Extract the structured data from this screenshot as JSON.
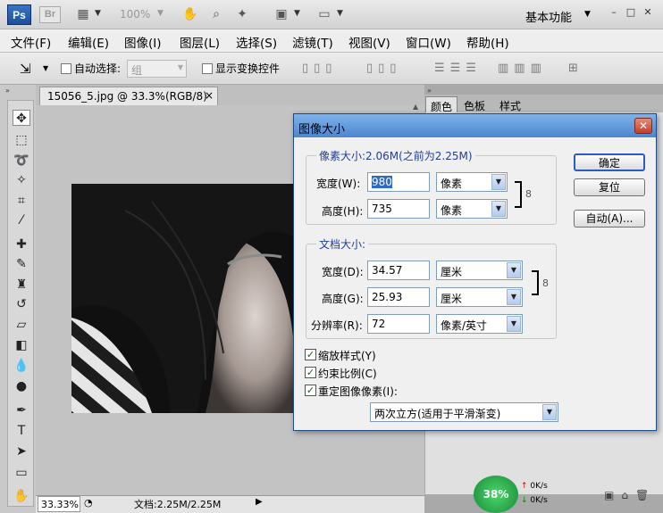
{
  "app": {
    "logo": "Ps",
    "bridge_logo": "Br",
    "zoom_level": "100%",
    "workspace": "基本功能",
    "menus": [
      "文件(F)",
      "编辑(E)",
      "图像(I)",
      "图层(L)",
      "选择(S)",
      "滤镜(T)",
      "视图(V)",
      "窗口(W)",
      "帮助(H)"
    ]
  },
  "options": {
    "auto_select_label": "自动选择:",
    "auto_select_value": "组",
    "show_transform_label": "显示变换控件"
  },
  "document": {
    "tab_title": "15056_5.jpg @ 33.3%(RGB/8)",
    "zoom": "33.33%",
    "doc_size": "文档:2.25M/2.25M"
  },
  "panels": {
    "tabs": [
      "颜色",
      "色板",
      "样式"
    ]
  },
  "dialog": {
    "title": "图像大小",
    "pixel_group_label": "像素大小:2.06M(之前为2.25M)",
    "pixel_width_label": "宽度(W):",
    "pixel_width_value": "980",
    "pixel_width_unit": "像素",
    "pixel_height_label": "高度(H):",
    "pixel_height_value": "735",
    "pixel_height_unit": "像素",
    "doc_group_label": "文档大小:",
    "doc_width_label": "宽度(D):",
    "doc_width_value": "34.57",
    "doc_width_unit": "厘米",
    "doc_height_label": "高度(G):",
    "doc_height_value": "25.93",
    "doc_height_unit": "厘米",
    "resolution_label": "分辨率(R):",
    "resolution_value": "72",
    "resolution_unit": "像素/英寸",
    "scale_styles_label": "缩放样式(Y)",
    "constrain_label": "约束比例(C)",
    "resample_label": "重定图像像素(I):",
    "resample_method": "两次立方(适用于平滑渐变)",
    "ok_label": "确定",
    "reset_label": "复位",
    "auto_label": "自动(A)..."
  },
  "overlay": {
    "net_percent": "38%",
    "up_speed": "0K/s",
    "down_speed": "0K/s"
  },
  "colors": {
    "dialog_title_bar": "#4c86cf",
    "group_label": "#1f3f9a",
    "close_button": "#c6402a",
    "net_widget": "#178a38"
  }
}
